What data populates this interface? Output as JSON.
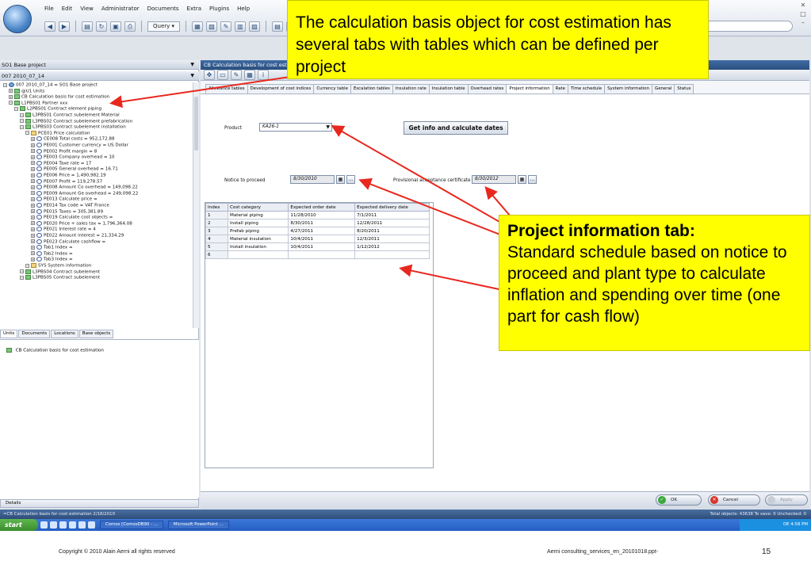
{
  "app": {
    "menu": [
      "File",
      "Edit",
      "View",
      "Administrator",
      "Documents",
      "Extra",
      "Plugins",
      "Help"
    ],
    "query_label": "Query ▾"
  },
  "left_panel": {
    "header1": "SO1 Base project",
    "header2": "007 2010_07_14",
    "tree": [
      {
        "indent": 0,
        "icon": "globe",
        "text": "007 2010_07_14 = SO1 Base project"
      },
      {
        "indent": 1,
        "icon": "x",
        "text": "@U1 Units"
      },
      {
        "indent": 1,
        "icon": "x",
        "text": "CB Calculation basis for cost estimation"
      },
      {
        "indent": 1,
        "icon": "x",
        "text": "L1PBS01 Partner xxx"
      },
      {
        "indent": 2,
        "icon": "x",
        "text": "L2PBS01 Contract element piping"
      },
      {
        "indent": 3,
        "icon": "x",
        "text": "L3PBS01 Contract subelement Material"
      },
      {
        "indent": 3,
        "icon": "x",
        "text": "L3PBS02 Contract subelement prefabrication"
      },
      {
        "indent": 3,
        "icon": "x",
        "text": "L3PBS03 Contract subelement installation"
      },
      {
        "indent": 4,
        "icon": "folder",
        "text": "PCE01 Price calculation"
      },
      {
        "indent": 5,
        "icon": "info",
        "text": "CE008 Total costs = 952,172.88"
      },
      {
        "indent": 5,
        "icon": "info",
        "text": "PE001 Customer currency = US Dollar"
      },
      {
        "indent": 5,
        "icon": "info",
        "text": "PE002 Profit margin = 8"
      },
      {
        "indent": 5,
        "icon": "info",
        "text": "PE003 Company overhead = 10"
      },
      {
        "indent": 5,
        "icon": "info",
        "text": "PE004 Taxe rate = 17"
      },
      {
        "indent": 5,
        "icon": "info",
        "text": "PE005 General overhead = 16.71"
      },
      {
        "indent": 5,
        "icon": "info",
        "text": "PE006 Price = 1,490,982.19"
      },
      {
        "indent": 5,
        "icon": "info",
        "text": "PE007 Profit = 119,278.57"
      },
      {
        "indent": 5,
        "icon": "info",
        "text": "PE008 Amount Co overhead = 149,098.22"
      },
      {
        "indent": 5,
        "icon": "info",
        "text": "PE009 Amount Ge overhead = 249,098.22"
      },
      {
        "indent": 5,
        "icon": "info",
        "text": "PE013 Calculate price ="
      },
      {
        "indent": 5,
        "icon": "info",
        "text": "PE014 Tax code = VAT France"
      },
      {
        "indent": 5,
        "icon": "info",
        "text": "PE015 Taxes = 305,381.89"
      },
      {
        "indent": 5,
        "icon": "info",
        "text": "PE019 Calculate cost objects ="
      },
      {
        "indent": 5,
        "icon": "info",
        "text": "PE020 Price + sales tax = 1,796,364.08"
      },
      {
        "indent": 5,
        "icon": "info",
        "text": "PE021 Interest rate = 4"
      },
      {
        "indent": 5,
        "icon": "info",
        "text": "PE022 Amount interest = 21,334.29"
      },
      {
        "indent": 5,
        "icon": "info",
        "text": "PE023 Calculate cashflow ="
      },
      {
        "indent": 5,
        "icon": "info",
        "text": "Tab1 Index ="
      },
      {
        "indent": 5,
        "icon": "info",
        "text": "Tab2 Index ="
      },
      {
        "indent": 5,
        "icon": "info",
        "text": "Tab3 Index ="
      },
      {
        "indent": 4,
        "icon": "folder",
        "text": "SYS System information"
      },
      {
        "indent": 3,
        "icon": "x",
        "text": "L3PBS04 Contract subelement"
      },
      {
        "indent": 3,
        "icon": "x",
        "text": "L3PBS05 Contract subelement"
      }
    ],
    "tabs": [
      "Units",
      "Documents",
      "Locations",
      "Base objects"
    ],
    "lower_item": "CB Calculation basis for cost estimation",
    "details_label": "Details"
  },
  "right_panel": {
    "header": "CB Calculation basis for cost estimation",
    "tabs": [
      "Allowance tables",
      "Development of cost indices",
      "Currency table",
      "Escalation tables",
      "Insulation rate",
      "Insulation table",
      "Overhead rates",
      "Project information",
      "Rate",
      "Time schedule",
      "System information",
      "General",
      "Status"
    ],
    "active_tab": "Project information",
    "product_label": "Product",
    "product_value": "KA26-1",
    "calc_button": "Get info and calculate dates",
    "notice_label": "Notice to proceed",
    "notice_date": "8/30/2010",
    "pac_label": "Provisional acceptance certificate",
    "pac_date": "8/30/2012",
    "ellipsis": "...",
    "grid_columns": [
      "Index",
      "Cost category",
      "Expected order date",
      "Expected delivery date"
    ],
    "grid_rows": [
      [
        "1",
        "Material piping",
        "11/28/2010",
        "7/1/2011"
      ],
      [
        "2",
        "Install piping",
        "8/30/2011",
        "12/28/2011"
      ],
      [
        "3",
        "Prefab piping",
        "4/27/2011",
        "8/20/2011"
      ],
      [
        "4",
        "Material insulation",
        "10/4/2011",
        "12/3/2011"
      ],
      [
        "5",
        "Install insulation",
        "10/4/2011",
        "1/12/2012"
      ],
      [
        "6",
        "",
        "",
        ""
      ]
    ],
    "buttons": {
      "ok": "OK",
      "cancel": "Cancel",
      "apply": "Apply"
    }
  },
  "status": {
    "left": "=CB Calculation basis for cost estimation 2/18/2010",
    "right": "Total objects: 43638 To save: 0 Unchecked: 0"
  },
  "taskbar": {
    "start": "start",
    "tasks": [
      "Comos [ComosDB90 - ...",
      "Microsoft PowerPoint ..."
    ],
    "tray": "DE 4:58 PM"
  },
  "callouts": {
    "top": "The calculation basis object for cost estimation has several tabs with tables which can be defined per project",
    "right_title": "Project information tab:",
    "right_body": "Standard schedule based on notice to proceed and plant type to calculate inflation and spending over time (one part for cash flow)"
  },
  "slide_footer": {
    "copyright": "Copyright © 2010 Alain Aerni all rights reserved",
    "filename": "Aerni consulting_services_en_20101018.ppt-",
    "page": "15"
  },
  "colors": {
    "callout": "#ffff00",
    "arrow": "#e8281e"
  }
}
